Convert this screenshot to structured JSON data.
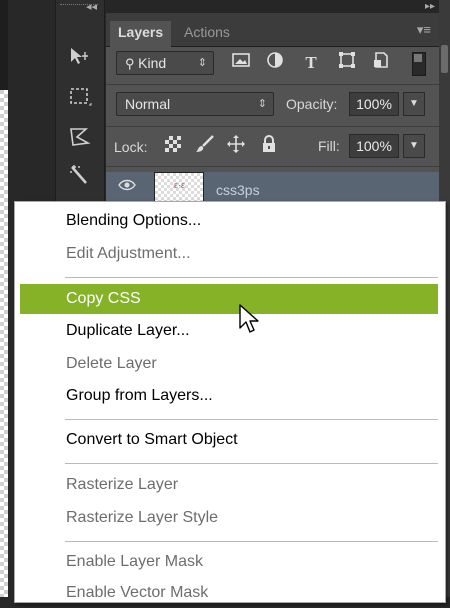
{
  "colors": {
    "accent_highlight": "#86b227",
    "panel_bg": "#535353",
    "dark_bg": "#282828"
  },
  "panel": {
    "tabs": [
      {
        "label": "Layers",
        "active": true
      },
      {
        "label": "Actions",
        "active": false
      }
    ],
    "filter": {
      "kind_label": "Kind",
      "icons": [
        "image-filter-icon",
        "adjustment-filter-icon",
        "type-filter-icon",
        "shape-filter-icon",
        "smart-object-filter-icon"
      ]
    },
    "blend_mode": "Normal",
    "opacity_label": "Opacity:",
    "opacity_value": "100%",
    "lock_label": "Lock:",
    "fill_label": "Fill:",
    "fill_value": "100%",
    "layer_name": "css3ps"
  },
  "tools": [
    "move-tool-icon",
    "marquee-tool-icon",
    "lasso-tool-icon",
    "magic-wand-tool-icon"
  ],
  "context_menu": {
    "items": [
      {
        "label": "Blending Options...",
        "enabled": true
      },
      {
        "label": "Edit Adjustment...",
        "enabled": false
      },
      {
        "label": "Copy CSS",
        "enabled": true,
        "highlighted": true
      },
      {
        "label": "Duplicate Layer...",
        "enabled": true
      },
      {
        "label": "Delete Layer",
        "enabled": false
      },
      {
        "label": "Group from Layers...",
        "enabled": true
      },
      {
        "label": "Convert to Smart Object",
        "enabled": true
      },
      {
        "label": "Rasterize Layer",
        "enabled": false
      },
      {
        "label": "Rasterize Layer Style",
        "enabled": false
      },
      {
        "label": "Enable Layer Mask",
        "enabled": false
      },
      {
        "label": "Enable Vector Mask",
        "enabled": false
      }
    ]
  }
}
